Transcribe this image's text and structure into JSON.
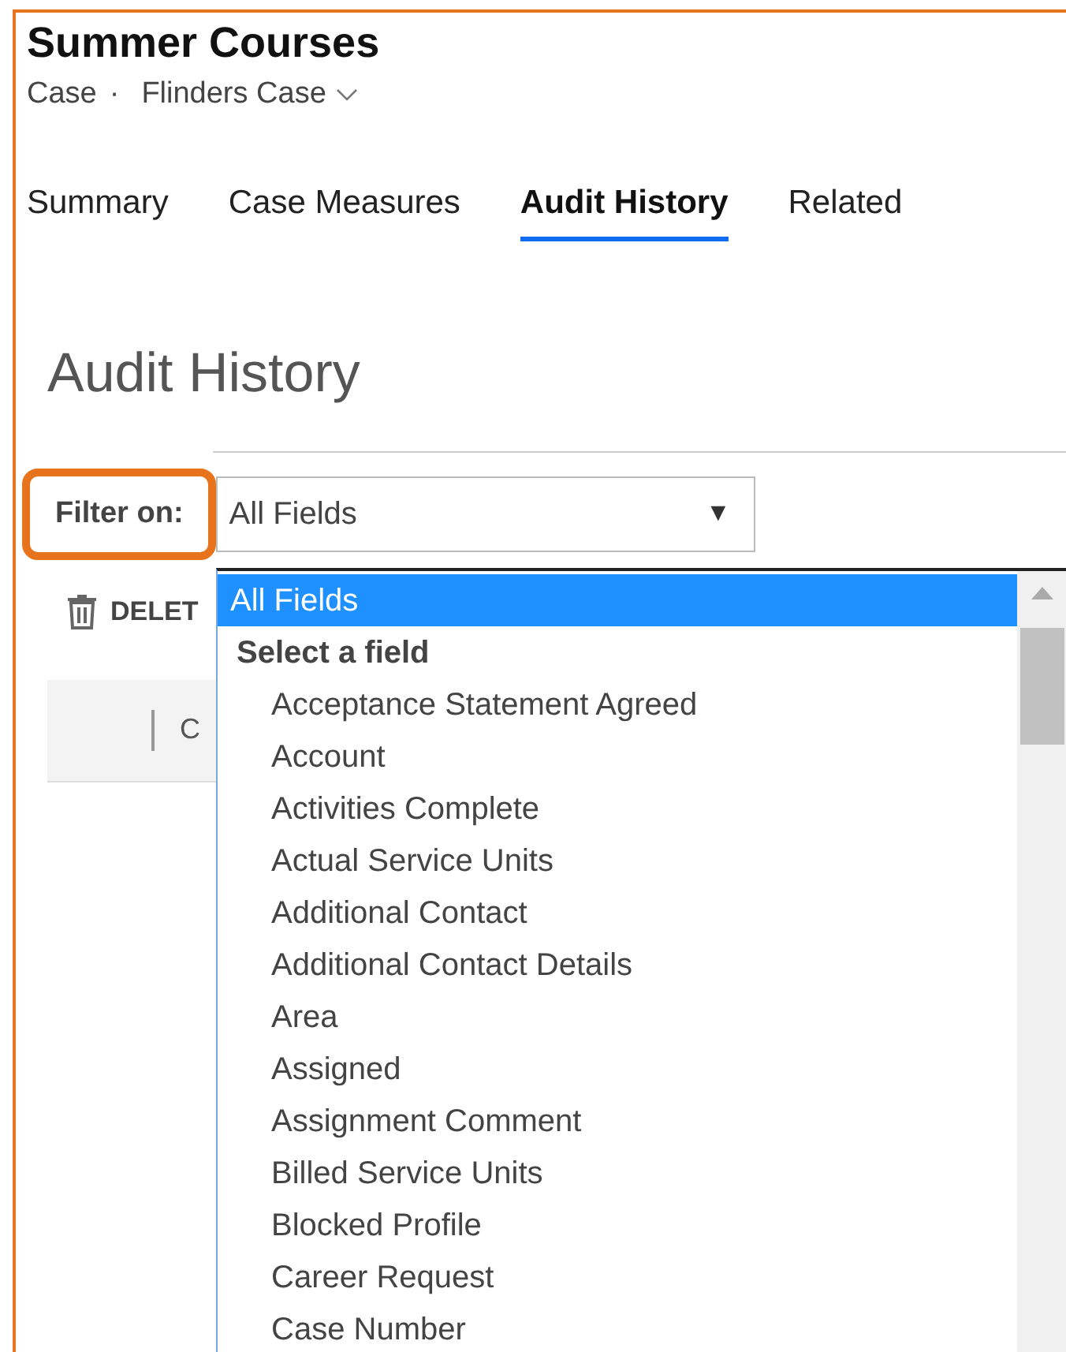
{
  "record": {
    "title": "Summer Courses",
    "entity": "Case",
    "separator": "·",
    "form": "Flinders Case"
  },
  "tabs": [
    {
      "label": "Summary",
      "selected": false
    },
    {
      "label": "Case Measures",
      "selected": false
    },
    {
      "label": "Audit History",
      "selected": true
    },
    {
      "label": "Related",
      "selected": false
    }
  ],
  "section": {
    "heading": "Audit History"
  },
  "filter": {
    "label": "Filter on:",
    "highlighted": true,
    "value": "All Fields",
    "arrow": "▼"
  },
  "toolbar": {
    "delete_label": "DELET"
  },
  "grid": {
    "column_1": "C"
  },
  "dropdown": {
    "options": [
      {
        "label": "All Fields",
        "kind": "option",
        "selected": true
      },
      {
        "label": "Select a field",
        "kind": "group",
        "selected": false
      },
      {
        "label": "Acceptance Statement Agreed",
        "kind": "option",
        "selected": false
      },
      {
        "label": "Account",
        "kind": "option",
        "selected": false
      },
      {
        "label": "Activities Complete",
        "kind": "option",
        "selected": false
      },
      {
        "label": "Actual Service Units",
        "kind": "option",
        "selected": false
      },
      {
        "label": "Additional Contact",
        "kind": "option",
        "selected": false
      },
      {
        "label": "Additional Contact Details",
        "kind": "option",
        "selected": false
      },
      {
        "label": "Area",
        "kind": "option",
        "selected": false
      },
      {
        "label": "Assigned",
        "kind": "option",
        "selected": false
      },
      {
        "label": "Assignment Comment",
        "kind": "option",
        "selected": false
      },
      {
        "label": "Billed Service Units",
        "kind": "option",
        "selected": false
      },
      {
        "label": "Blocked Profile",
        "kind": "option",
        "selected": false
      },
      {
        "label": "Career Request",
        "kind": "option",
        "selected": false
      },
      {
        "label": "Case Number",
        "kind": "option",
        "selected": false
      }
    ]
  }
}
